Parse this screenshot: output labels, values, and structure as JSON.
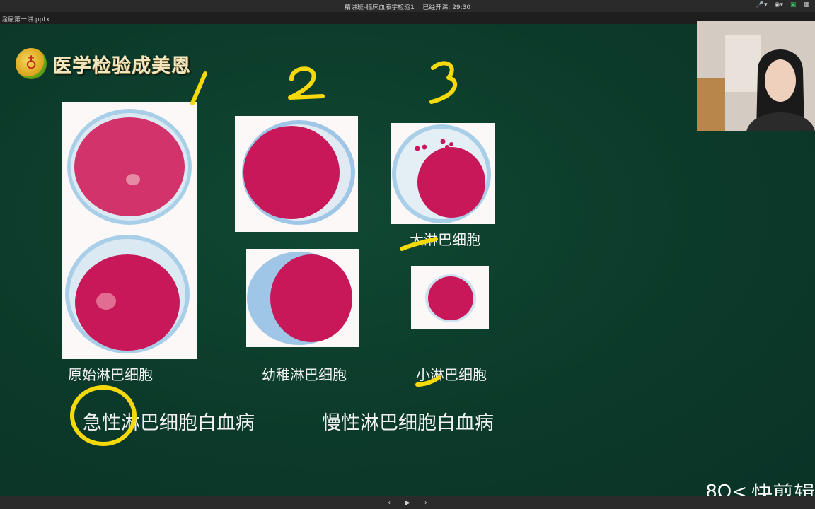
{
  "window": {
    "title": "精讲班-临床血液学检验1",
    "status": "已经开课: 29:30"
  },
  "tab": {
    "label": "淦最第一讲.pptx"
  },
  "slide": {
    "logo_text": "医学检验成美恩",
    "cell_labels": {
      "col1": "原始淋巴细胞",
      "col2": "幼稚淋巴细胞",
      "large": "大淋巴细胞",
      "small": "小淋巴细胞"
    },
    "disease_labels": {
      "acute": "急性淋巴细胞白血病",
      "chronic": "慢性淋巴细胞白血病"
    },
    "annotations": [
      "1",
      "2",
      "3"
    ]
  },
  "watermark": {
    "text": "快剪辑"
  },
  "colors": {
    "slide_bg": "#0e3a2c",
    "annotation": "#f5d90a",
    "cell_nucleus": "#c8185a",
    "cytoplasm": "#9fc6e6"
  }
}
